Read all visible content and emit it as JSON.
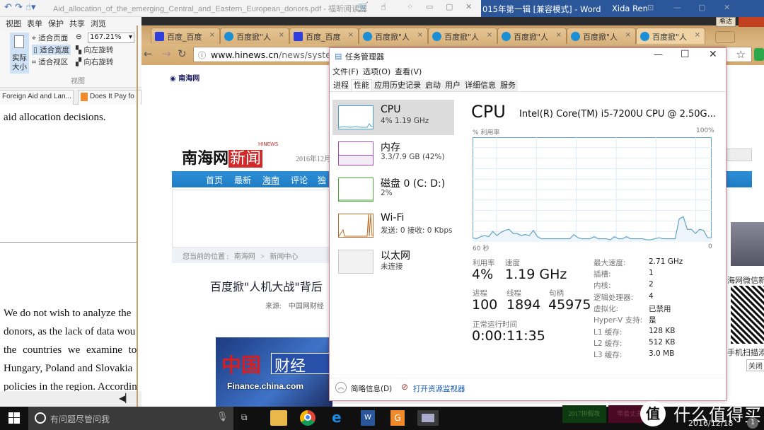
{
  "foxit": {
    "title": "Aid_allocation_of_the_emerging_Central_and_Eastern_European_donors.pdf - 福昕阅读器",
    "menu": [
      "视图",
      "表单",
      "保护",
      "共享",
      "浏览"
    ],
    "ribbon": {
      "actual_size": "实际大小",
      "fit_page": "适合页面",
      "fit_width": "适合宽度",
      "fit_view": "适合视区",
      "zoom_value": "167.21%",
      "rotate_left": "向左旋转",
      "rotate_right": "向右旋转",
      "group_label": "视图"
    },
    "doc_tabs": [
      "Foreign Aid and Lan...",
      "Does It Pay fo"
    ],
    "text_top": "aid allocation decisions.",
    "text_lines": [
      "We do not wish to analyze the",
      "donors, as the lack of data wou",
      "the  countries  we  examine  to",
      "Hungary, Poland and Slovakia",
      "policies in the region. Accordin"
    ]
  },
  "word": {
    "title": "015年第一辑 [兼容模式] - Word",
    "user": "Xida Ren"
  },
  "chrome": {
    "tabs": [
      {
        "label": "百度_百度",
        "icon": "paw"
      },
      {
        "label": "百度掀\"人",
        "icon": "swirl"
      },
      {
        "label": "百度_百度",
        "icon": "paw"
      },
      {
        "label": "百度掀\"人",
        "icon": "swirl"
      },
      {
        "label": "百度掀\"人",
        "icon": "swirl"
      },
      {
        "label": "百度掀\"人",
        "icon": "swirl"
      },
      {
        "label": "百度掀\"人",
        "icon": "swirl"
      },
      {
        "label": "百度掀\"人",
        "icon": "swirl"
      }
    ],
    "url_host": "www.hinews.cn",
    "url_path": "/news/system/",
    "profile": "希达"
  },
  "webpage": {
    "logo": "南海网新闻",
    "logo_tag": "HINEWS",
    "date": "2016年12月",
    "nav": [
      "首页",
      "最新",
      "海南",
      "评论",
      "独"
    ],
    "breadcrumb": [
      "您当前的位置 :",
      "南海网",
      ">",
      "新闻中心"
    ],
    "headline": "百度掀\"人机大战\"背后",
    "source": "来源:    中国网财经",
    "image_caption": "Finance.china.com",
    "right_side": {
      "wechat": "海网微信新",
      "scan": "手机扫描添",
      "close": "关闭"
    }
  },
  "taskmanager": {
    "title": "任务管理器",
    "menu": [
      "文件(F)",
      "选项(O)",
      "查看(V)"
    ],
    "tabs": [
      "进程",
      "性能",
      "应用历史记录",
      "启动",
      "用户",
      "详细信息",
      "服务"
    ],
    "active_tab": "性能",
    "sidebar": [
      {
        "name": "CPU",
        "sub": "4% 1.19 GHz",
        "color": "#4aa3c8"
      },
      {
        "name": "内存",
        "sub": "3.3/7.9 GB (42%)",
        "color": "#9b4fb4"
      },
      {
        "name": "磁盘 0 (C: D:)",
        "sub": "2%",
        "color": "#4ca63a"
      },
      {
        "name": "Wi-Fi",
        "sub": "发送: 0 接收: 0 Kbps",
        "color": "#b9702d"
      },
      {
        "name": "以太网",
        "sub": "未连接",
        "color": "#aaaaaa"
      }
    ],
    "main": {
      "heading": "CPU",
      "model": "Intel(R) Core(TM) i5-7200U CPU @ 2.50G...",
      "ylabel": "% 利用率",
      "ymax": "100%",
      "xleft": "60 秒",
      "xright": "0",
      "stats": {
        "util_label": "利用率",
        "util": "4%",
        "speed_label": "速度",
        "speed": "1.19 GHz",
        "proc_label": "进程",
        "proc": "100",
        "thread_label": "线程",
        "thread": "1894",
        "handle_label": "句柄",
        "handle": "45975",
        "uptime_label": "正常运行时间",
        "uptime": "0:00:11:35"
      },
      "details": [
        {
          "k": "最大速度:",
          "v": "2.71 GHz"
        },
        {
          "k": "插槽:",
          "v": "1"
        },
        {
          "k": "内核:",
          "v": "2"
        },
        {
          "k": "逻辑处理器:",
          "v": "4"
        },
        {
          "k": "虚拟化:",
          "v": "已禁用"
        },
        {
          "k": "Hyper-V 支持:",
          "v": "是"
        },
        {
          "k": "L1 缓存:",
          "v": "128 KB"
        },
        {
          "k": "L2 缓存:",
          "v": "512 KB"
        },
        {
          "k": "L3 缓存:",
          "v": "3.0 MB"
        }
      ],
      "cpu_history": [
        4,
        3,
        5,
        6,
        5,
        10,
        6,
        9,
        11,
        12,
        8,
        8,
        6,
        7,
        6,
        11,
        5,
        3,
        3,
        3,
        3,
        3,
        3,
        3,
        3,
        7,
        4,
        3,
        3,
        3,
        5,
        3,
        3,
        3,
        2,
        5,
        3,
        3,
        5,
        3,
        3,
        3,
        3,
        2,
        2,
        3,
        4,
        3,
        3,
        3,
        3,
        22,
        24,
        12,
        12,
        8,
        12,
        11,
        4,
        4
      ]
    },
    "footer": {
      "less": "简略信息(D)",
      "monitor": "打开资源监视器"
    }
  },
  "taskbar": {
    "search_placeholder": "有问题尽管问我",
    "date": "2016/12/18",
    "notification_count": "1",
    "watermark": "什么值得买",
    "tiles": [
      "2017拼假攻",
      "带着丈夫"
    ]
  }
}
